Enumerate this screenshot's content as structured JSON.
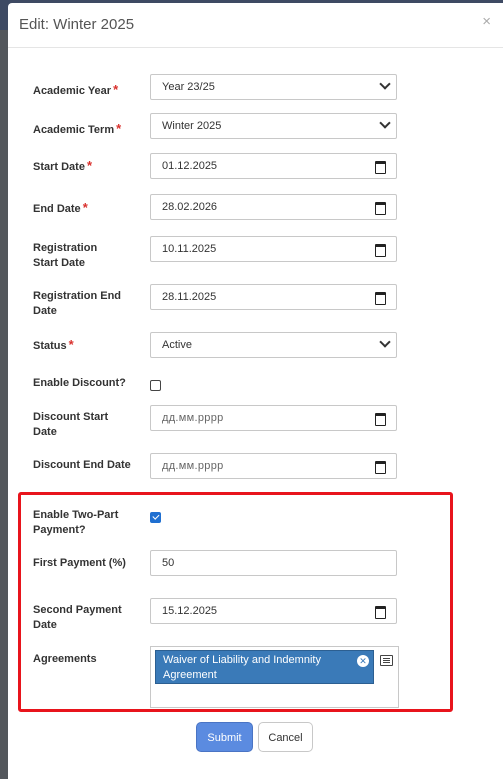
{
  "modal": {
    "title": "Edit: Winter 2025",
    "close_label": "×"
  },
  "form": {
    "academic_year": {
      "label": "Academic Year",
      "required": "*",
      "value": "Year 23/25"
    },
    "academic_term": {
      "label": "Academic Term",
      "required": "*",
      "value": "Winter 2025"
    },
    "start_date": {
      "label": "Start Date",
      "required": "*",
      "value": "01.12.2025"
    },
    "end_date": {
      "label": "End Date",
      "required": "*",
      "value": "28.02.2026"
    },
    "registration_start_date": {
      "label": "Registration Start Date",
      "value": "10.11.2025"
    },
    "registration_end_date": {
      "label": "Registration End Date",
      "value": "28.11.2025"
    },
    "status": {
      "label": "Status",
      "required": "*",
      "value": "Active"
    },
    "enable_discount": {
      "label": "Enable Discount?",
      "checked": false
    },
    "discount_start_date": {
      "label": "Discount Start Date",
      "placeholder": "дд.мм.рррр"
    },
    "discount_end_date": {
      "label": "Discount End Date",
      "placeholder": "дд.мм.рррр"
    },
    "enable_two_part_payment": {
      "label": "Enable Two-Part Payment?",
      "checked": true
    },
    "first_payment": {
      "label": "First Payment (%)",
      "value": "50"
    },
    "second_payment_date": {
      "label": "Second Payment Date",
      "value": "15.12.2025"
    },
    "agreements": {
      "label": "Agreements",
      "selected": [
        "Waiver of Liability and Indemnity Agreement"
      ]
    }
  },
  "buttons": {
    "submit": "Submit",
    "cancel": "Cancel"
  },
  "colors": {
    "required": "#d9302c",
    "highlight": "#e8141c",
    "tag": "#3a7ab8",
    "submit": "#5b8be0"
  }
}
